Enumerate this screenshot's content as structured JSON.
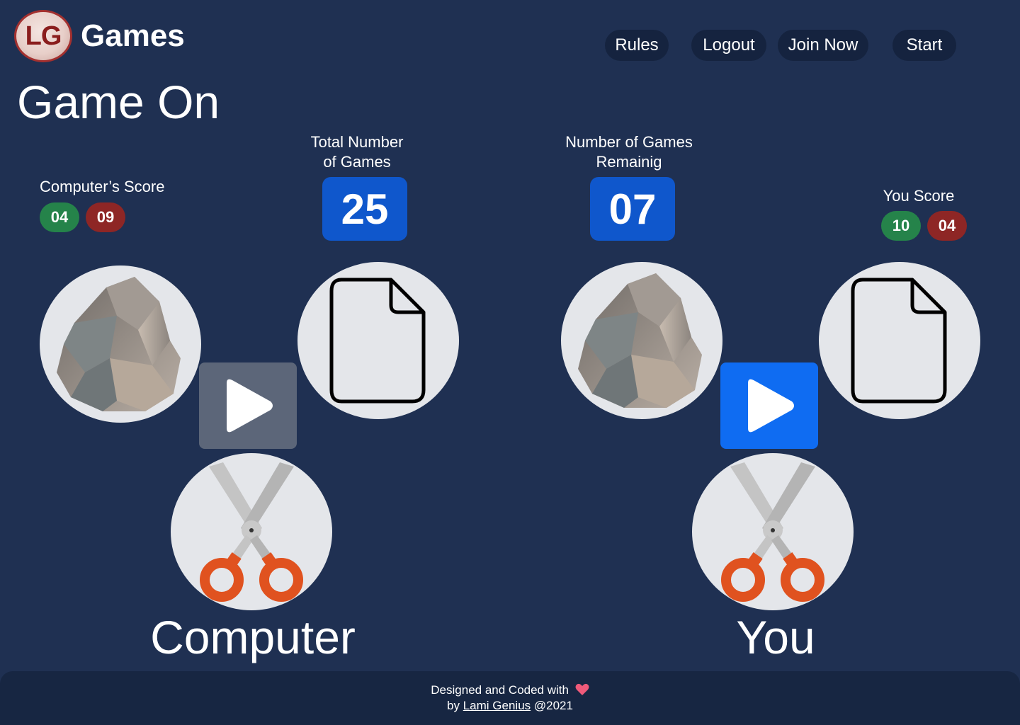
{
  "header": {
    "logo_text": "LG",
    "brand": "Games",
    "nav": {
      "rules": "Rules",
      "logout": "Logout",
      "join": "Join Now",
      "start": "Start"
    }
  },
  "page_title": "Game On",
  "computer": {
    "score_label": "Computer’s Score",
    "wins": "04",
    "losses": "09",
    "name": "Computer"
  },
  "you": {
    "score_label": "You Score",
    "wins": "10",
    "losses": "04",
    "name": "You"
  },
  "total_games": {
    "label_line1": "Total Number",
    "label_line2": "of Games",
    "value": "25"
  },
  "remaining_games": {
    "label_line1": "Number of Games",
    "label_line2": "Remainig",
    "value": "07"
  },
  "choices": [
    "rock",
    "paper",
    "scissors"
  ],
  "play_buttons": {
    "computer_color": "#5c6679",
    "you_color": "#0f6cf2"
  },
  "colors": {
    "background": "#1f3052",
    "win": "#25834a",
    "loss": "#8e2625",
    "counter": "#0f57cc",
    "heart": "#ef5a7a"
  },
  "footer": {
    "line1": "Designed and Coded with",
    "by": "by",
    "author": "Lami Genius",
    "year": "@2021"
  }
}
